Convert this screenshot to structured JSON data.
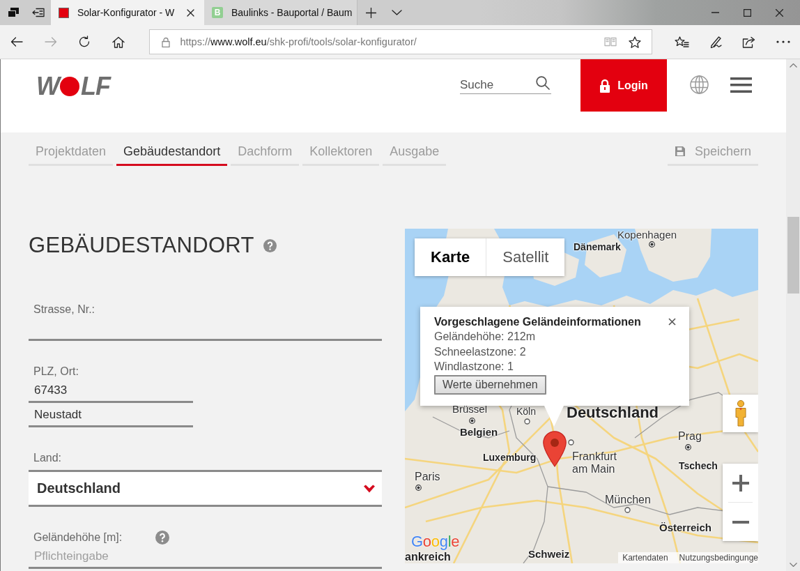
{
  "browser": {
    "tabs": [
      {
        "title": "Solar-Konfigurator - W",
        "selected": true
      },
      {
        "title": "Baulinks - Bauportal / Baum",
        "selected": false,
        "favicon_text": "B"
      }
    ],
    "nav_buttons": [
      {
        "kind": "back",
        "disabled": false
      },
      {
        "kind": "forward",
        "disabled": true
      },
      {
        "kind": "refresh",
        "disabled": false
      },
      {
        "kind": "home",
        "disabled": false
      }
    ],
    "address": {
      "scheme": "https://",
      "host": "www.wolf.eu",
      "path": "/shk-profi/tools/solar-konfigurator/"
    }
  },
  "header": {
    "logo": {
      "before": "W",
      "after": "LF"
    },
    "search": {
      "placeholder": "Suche"
    },
    "login": "Login"
  },
  "steps": [
    {
      "label": "Projektdaten",
      "selected": false
    },
    {
      "label": "Gebäudestandort",
      "selected": true
    },
    {
      "label": "Dachform",
      "selected": false
    },
    {
      "label": "Kollektoren",
      "selected": false
    },
    {
      "label": "Ausgabe",
      "selected": false
    }
  ],
  "save": "Speichern",
  "form": {
    "title": "GEBÄUDESTANDORT",
    "title_help": true,
    "fields": [
      {
        "kind": "text",
        "label": "Strasse, Nr.:",
        "help": false
      },
      {
        "kind": "pair",
        "label": "PLZ, Ort:",
        "help": false,
        "values": [
          "67433",
          "Neustadt"
        ]
      },
      {
        "kind": "select",
        "label": "Land:",
        "help": false,
        "value": "Deutschland"
      },
      {
        "kind": "text",
        "label": "Geländehöhe [m]:",
        "help": true,
        "placeholder": "Pflichteingabe"
      }
    ]
  },
  "map": {
    "map_types": [
      {
        "label": "Karte",
        "selected": true
      },
      {
        "label": "Satellit",
        "selected": false
      }
    ],
    "labels": [
      {
        "text": "Kopenhagen",
        "kind": "capital"
      },
      {
        "text": "Dänemark",
        "kind": "country"
      },
      {
        "text": "Brüssel",
        "kind": "capital"
      },
      {
        "text": "Köln",
        "kind": "city"
      },
      {
        "text": "Deutschland",
        "kind": "country"
      },
      {
        "text": "Belgien",
        "kind": "country"
      },
      {
        "text": "Prag",
        "kind": "capital"
      },
      {
        "text": "Luxemburg",
        "kind": "country"
      },
      {
        "text": "Frankfurt am Main",
        "kind": "city"
      },
      {
        "text": "Tschech",
        "kind": "country"
      },
      {
        "text": "Paris",
        "kind": "capital"
      },
      {
        "text": "München",
        "kind": "city"
      },
      {
        "text": "Österreich",
        "kind": "country"
      },
      {
        "text": "Schweiz",
        "kind": "country"
      },
      {
        "text": "ankreich",
        "kind": "country"
      }
    ],
    "info_window": {
      "title": "Vorgeschlagene Geländeinformationen",
      "lines": [
        "Geländehöhe: 212m",
        "Schneelastzone: 2",
        "Windlastzone: 1"
      ],
      "button": "Werte übernehmen"
    },
    "google_logo": "Google",
    "attribution": [
      "Kartendaten",
      "Nutzungsbedingunge"
    ]
  }
}
